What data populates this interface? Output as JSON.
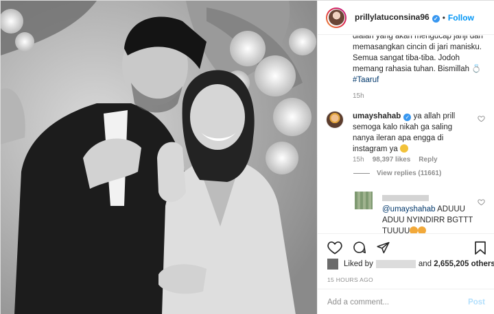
{
  "post": {
    "username": "prillylatuconsina96",
    "separator": "•",
    "follow_label": "Follow",
    "caption_lines": [
      "dialah yang akan mengucap janji dan",
      "memasangkan cincin di jari manisku.",
      "Semua sangat tiba-tiba. Jodoh",
      "memang rahasia tuhan. Bismillah 💍"
    ],
    "hashtag": "#Taaruf",
    "caption_time": "15h"
  },
  "comment": {
    "username": "umayshahab",
    "text_lines": [
      " ya allah prill",
      "semoga kalo nikah ga saling",
      "nanya ileran apa engga di",
      "instagram ya"
    ],
    "time": "15h",
    "likes": "98,397 likes",
    "reply_label": "Reply",
    "view_replies": "View replies (11661)"
  },
  "reply": {
    "mention": "@umayshahab",
    "text_lines": [
      " ADUUU",
      "ADUU NYINDIRR BGTTT",
      "TUUUU"
    ]
  },
  "likes": {
    "prefix": "Liked by",
    "middle": "and",
    "count": "2,655,205 others"
  },
  "timestamp": "15 HOURS AGO",
  "comment_box": {
    "placeholder": "Add a comment...",
    "post_label": "Post"
  },
  "icons": {
    "heart": "heart-icon",
    "comment": "comment-icon",
    "share": "share-icon",
    "bookmark": "bookmark-icon",
    "verified": "verified-badge-icon"
  },
  "colors": {
    "link_blue": "#0095f6",
    "hashtag_blue": "#00376b",
    "muted_grey": "#8e8e8e",
    "post_disabled": "#b2dffc"
  }
}
